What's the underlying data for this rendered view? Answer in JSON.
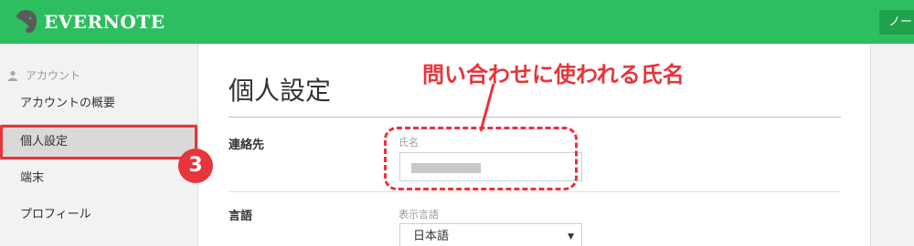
{
  "header": {
    "brand": "EVERNOTE",
    "button_label": "ノー"
  },
  "sidebar": {
    "section_label": "アカウント",
    "items": [
      {
        "label": "アカウントの概要",
        "selected": false
      },
      {
        "label": "個人設定",
        "selected": true
      },
      {
        "label": "端末",
        "selected": false
      },
      {
        "label": "プロフィール",
        "selected": false
      }
    ]
  },
  "main": {
    "title": "個人設定",
    "contact": {
      "section_label": "連絡先",
      "field_label": "氏名",
      "value": ""
    },
    "language": {
      "section_label": "言語",
      "field_label": "表示言語",
      "selected": "日本語"
    }
  },
  "annotation": {
    "callout": "問い合わせに使われる氏名",
    "step_badge": "3"
  },
  "colors": {
    "brand_green": "#2dbe60",
    "annotation_red": "#e8343c"
  }
}
